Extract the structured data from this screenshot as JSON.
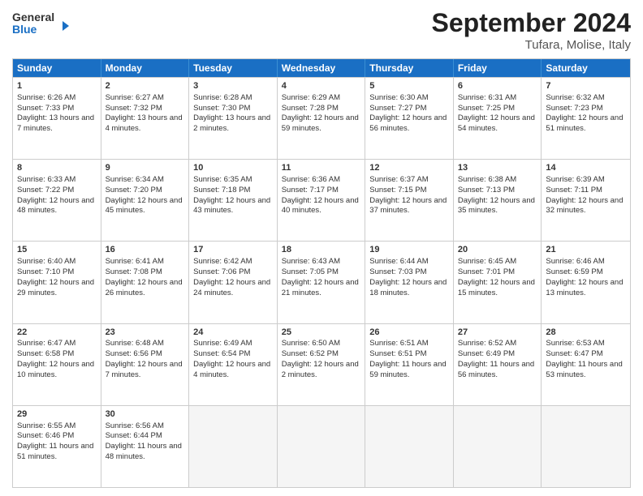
{
  "logo": {
    "line1": "General",
    "line2": "Blue",
    "arrow": "▶"
  },
  "title": "September 2024",
  "location": "Tufara, Molise, Italy",
  "days": [
    "Sunday",
    "Monday",
    "Tuesday",
    "Wednesday",
    "Thursday",
    "Friday",
    "Saturday"
  ],
  "rows": [
    [
      {
        "day": 1,
        "sunrise": "6:26 AM",
        "sunset": "7:33 PM",
        "daylight": "13 hours and 7 minutes."
      },
      {
        "day": 2,
        "sunrise": "6:27 AM",
        "sunset": "7:32 PM",
        "daylight": "13 hours and 4 minutes."
      },
      {
        "day": 3,
        "sunrise": "6:28 AM",
        "sunset": "7:30 PM",
        "daylight": "13 hours and 2 minutes."
      },
      {
        "day": 4,
        "sunrise": "6:29 AM",
        "sunset": "7:28 PM",
        "daylight": "12 hours and 59 minutes."
      },
      {
        "day": 5,
        "sunrise": "6:30 AM",
        "sunset": "7:27 PM",
        "daylight": "12 hours and 56 minutes."
      },
      {
        "day": 6,
        "sunrise": "6:31 AM",
        "sunset": "7:25 PM",
        "daylight": "12 hours and 54 minutes."
      },
      {
        "day": 7,
        "sunrise": "6:32 AM",
        "sunset": "7:23 PM",
        "daylight": "12 hours and 51 minutes."
      }
    ],
    [
      {
        "day": 8,
        "sunrise": "6:33 AM",
        "sunset": "7:22 PM",
        "daylight": "12 hours and 48 minutes."
      },
      {
        "day": 9,
        "sunrise": "6:34 AM",
        "sunset": "7:20 PM",
        "daylight": "12 hours and 45 minutes."
      },
      {
        "day": 10,
        "sunrise": "6:35 AM",
        "sunset": "7:18 PM",
        "daylight": "12 hours and 43 minutes."
      },
      {
        "day": 11,
        "sunrise": "6:36 AM",
        "sunset": "7:17 PM",
        "daylight": "12 hours and 40 minutes."
      },
      {
        "day": 12,
        "sunrise": "6:37 AM",
        "sunset": "7:15 PM",
        "daylight": "12 hours and 37 minutes."
      },
      {
        "day": 13,
        "sunrise": "6:38 AM",
        "sunset": "7:13 PM",
        "daylight": "12 hours and 35 minutes."
      },
      {
        "day": 14,
        "sunrise": "6:39 AM",
        "sunset": "7:11 PM",
        "daylight": "12 hours and 32 minutes."
      }
    ],
    [
      {
        "day": 15,
        "sunrise": "6:40 AM",
        "sunset": "7:10 PM",
        "daylight": "12 hours and 29 minutes."
      },
      {
        "day": 16,
        "sunrise": "6:41 AM",
        "sunset": "7:08 PM",
        "daylight": "12 hours and 26 minutes."
      },
      {
        "day": 17,
        "sunrise": "6:42 AM",
        "sunset": "7:06 PM",
        "daylight": "12 hours and 24 minutes."
      },
      {
        "day": 18,
        "sunrise": "6:43 AM",
        "sunset": "7:05 PM",
        "daylight": "12 hours and 21 minutes."
      },
      {
        "day": 19,
        "sunrise": "6:44 AM",
        "sunset": "7:03 PM",
        "daylight": "12 hours and 18 minutes."
      },
      {
        "day": 20,
        "sunrise": "6:45 AM",
        "sunset": "7:01 PM",
        "daylight": "12 hours and 15 minutes."
      },
      {
        "day": 21,
        "sunrise": "6:46 AM",
        "sunset": "6:59 PM",
        "daylight": "12 hours and 13 minutes."
      }
    ],
    [
      {
        "day": 22,
        "sunrise": "6:47 AM",
        "sunset": "6:58 PM",
        "daylight": "12 hours and 10 minutes."
      },
      {
        "day": 23,
        "sunrise": "6:48 AM",
        "sunset": "6:56 PM",
        "daylight": "12 hours and 7 minutes."
      },
      {
        "day": 24,
        "sunrise": "6:49 AM",
        "sunset": "6:54 PM",
        "daylight": "12 hours and 4 minutes."
      },
      {
        "day": 25,
        "sunrise": "6:50 AM",
        "sunset": "6:52 PM",
        "daylight": "12 hours and 2 minutes."
      },
      {
        "day": 26,
        "sunrise": "6:51 AM",
        "sunset": "6:51 PM",
        "daylight": "11 hours and 59 minutes."
      },
      {
        "day": 27,
        "sunrise": "6:52 AM",
        "sunset": "6:49 PM",
        "daylight": "11 hours and 56 minutes."
      },
      {
        "day": 28,
        "sunrise": "6:53 AM",
        "sunset": "6:47 PM",
        "daylight": "11 hours and 53 minutes."
      }
    ],
    [
      {
        "day": 29,
        "sunrise": "6:55 AM",
        "sunset": "6:46 PM",
        "daylight": "11 hours and 51 minutes."
      },
      {
        "day": 30,
        "sunrise": "6:56 AM",
        "sunset": "6:44 PM",
        "daylight": "11 hours and 48 minutes."
      },
      null,
      null,
      null,
      null,
      null
    ]
  ]
}
